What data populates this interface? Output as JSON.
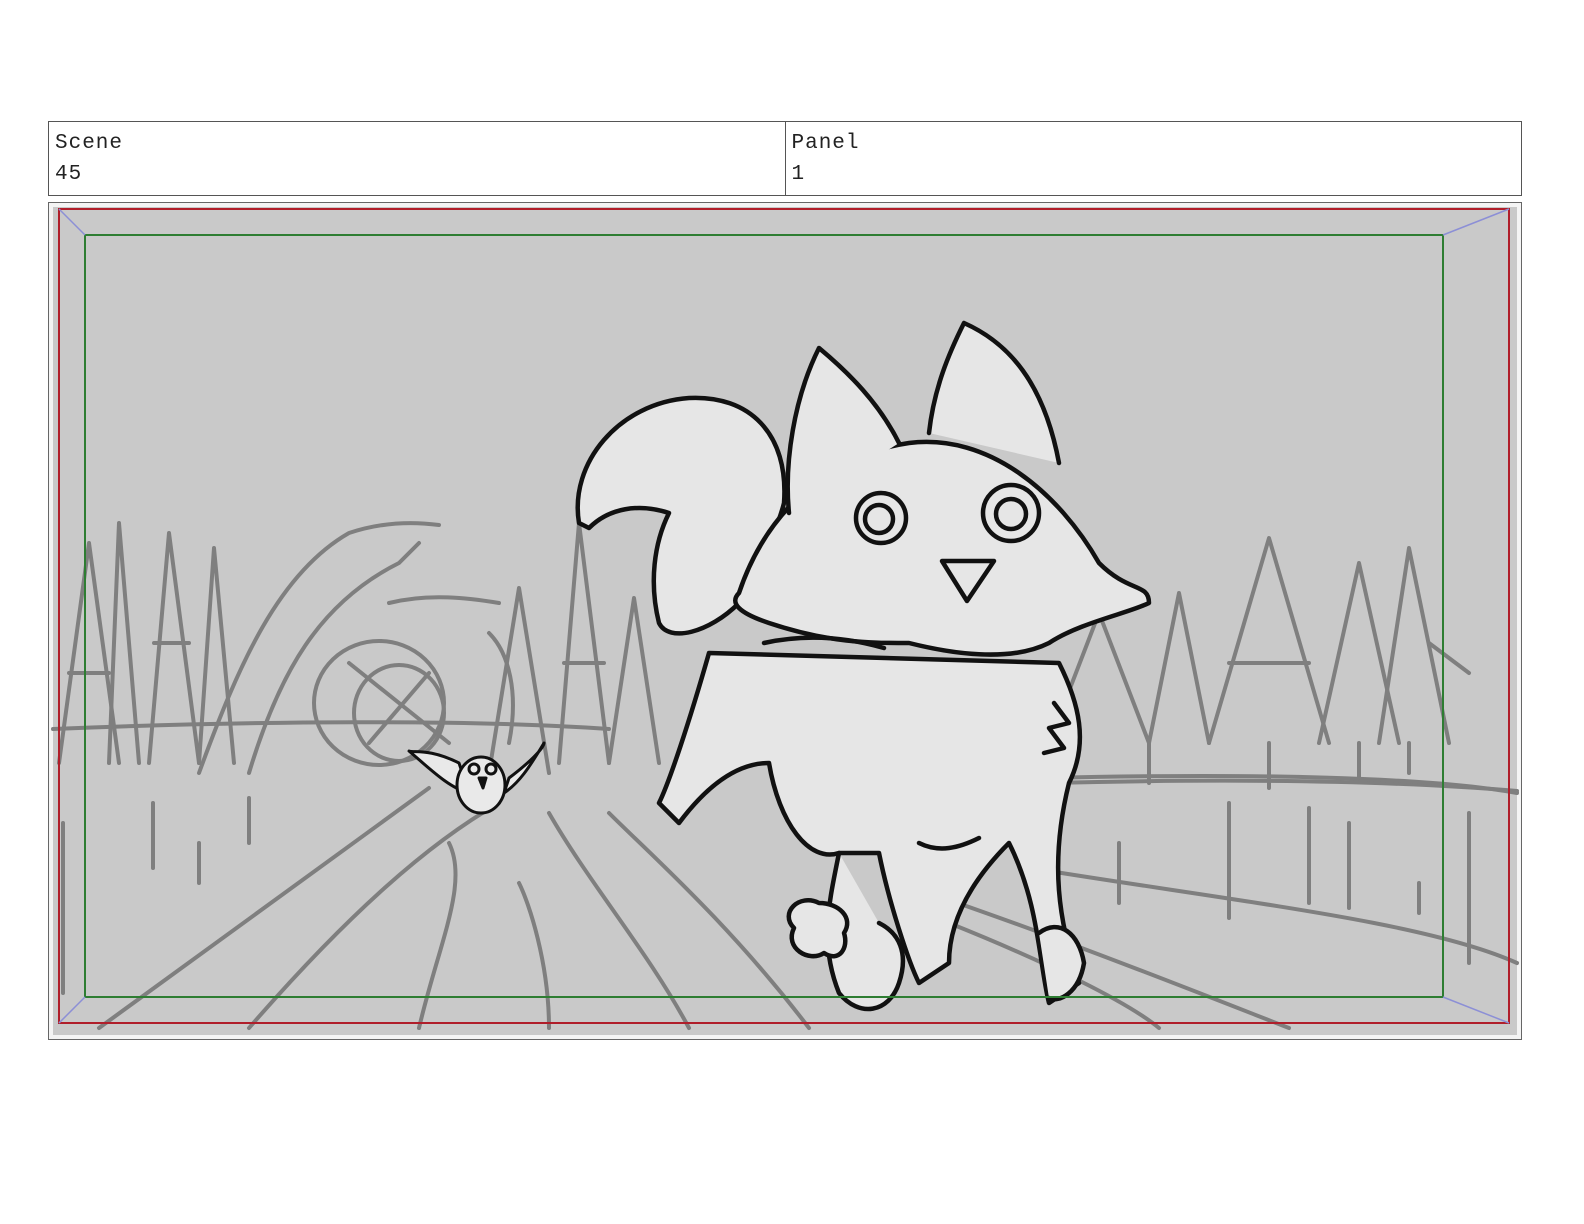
{
  "header": {
    "scene_label": "Scene",
    "scene_value": "45",
    "panel_label": "Panel",
    "panel_value": "1"
  },
  "colors": {
    "page_background": "#ffffff",
    "panel_background": "#c9c9c9",
    "background_sketch": "#7f7f7f",
    "character_fill": "#e6e6e6",
    "character_line": "#111111",
    "safe_area_outer": "#b01e2a",
    "safe_area_inner": "#2e7d32",
    "corner_guides": "#8c8fd6"
  },
  "drawing": {
    "subjects": [
      "fox-character",
      "owl-character",
      "forest-background",
      "road",
      "tree-arch"
    ]
  }
}
